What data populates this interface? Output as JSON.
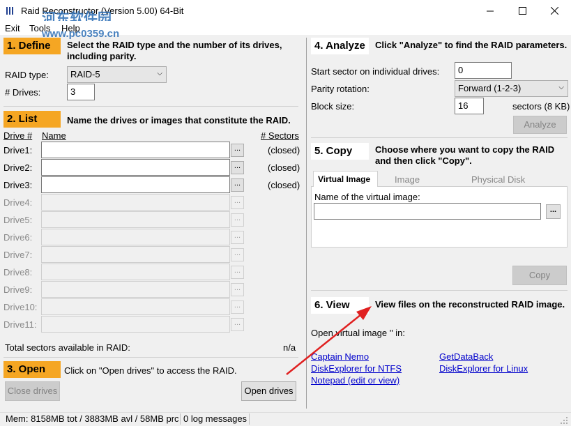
{
  "window": {
    "title": "Raid Reconstructor (Version 5.00) 64-Bit"
  },
  "watermark": {
    "line1": "河东软件园",
    "line2": "www.pc0359.cn"
  },
  "menu": [
    "Exit",
    "Tools",
    "Help"
  ],
  "define": {
    "tag": "1. Define",
    "desc": "Select the RAID type and the number of its drives, including parity.",
    "raid_type_label": "RAID type:",
    "raid_type_value": "RAID-5",
    "drives_label": "# Drives:",
    "drives_value": "3"
  },
  "list": {
    "tag": "2. List",
    "desc": "Name the drives or images that constitute the RAID.",
    "col_drive": "Drive #",
    "col_name": "Name",
    "col_sectors": "# Sectors",
    "dots": "...",
    "drives": [
      {
        "label": "Drive1:",
        "status": "(closed)",
        "enabled": true
      },
      {
        "label": "Drive2:",
        "status": "(closed)",
        "enabled": true
      },
      {
        "label": "Drive3:",
        "status": "(closed)",
        "enabled": true
      },
      {
        "label": "Drive4:",
        "status": "",
        "enabled": false
      },
      {
        "label": "Drive5:",
        "status": "",
        "enabled": false
      },
      {
        "label": "Drive6:",
        "status": "",
        "enabled": false
      },
      {
        "label": "Drive7:",
        "status": "",
        "enabled": false
      },
      {
        "label": "Drive8:",
        "status": "",
        "enabled": false
      },
      {
        "label": "Drive9:",
        "status": "",
        "enabled": false
      },
      {
        "label": "Drive10:",
        "status": "",
        "enabled": false
      },
      {
        "label": "Drive11:",
        "status": "",
        "enabled": false
      }
    ],
    "total_label": "Total sectors available in RAID:",
    "total_value": "n/a"
  },
  "open": {
    "tag": "3. Open",
    "desc": "Click on \"Open drives\" to access the RAID.",
    "close_btn": "Close drives",
    "open_btn": "Open drives"
  },
  "analyze": {
    "tag": "4. Analyze",
    "desc": "Click \"Analyze\" to find the RAID parameters.",
    "start_label": "Start sector on individual drives:",
    "start_value": "0",
    "parity_label": "Parity rotation:",
    "parity_value": "Forward (1-2-3)",
    "block_label": "Block size:",
    "block_value": "16",
    "block_unit": "sectors (8 KB)",
    "analyze_btn": "Analyze"
  },
  "copy": {
    "tag": "5. Copy",
    "desc": "Choose where you want to copy the RAID and then click \"Copy\".",
    "tabs": [
      "Virtual Image",
      "Image",
      "Physical Disk"
    ],
    "name_label": "Name of the virtual image:",
    "name_value": "",
    "browse": "...",
    "copy_btn": "Copy"
  },
  "view": {
    "tag": "6. View",
    "desc": "View files on the reconstructed RAID image.",
    "open_label": "Open virtual image '' in:",
    "links": [
      "Captain Nemo",
      "DiskExplorer for NTFS",
      "Notepad (edit or view)",
      "GetDataBack",
      "DiskExplorer for Linux"
    ]
  },
  "status": {
    "mem": "Mem: 8158MB tot / 3883MB avl / 58MB prc",
    "log": "0 log messages"
  },
  "colors": {
    "section_tag": "#f5a623",
    "link": "#0000cc",
    "arrow": "#e02020"
  }
}
